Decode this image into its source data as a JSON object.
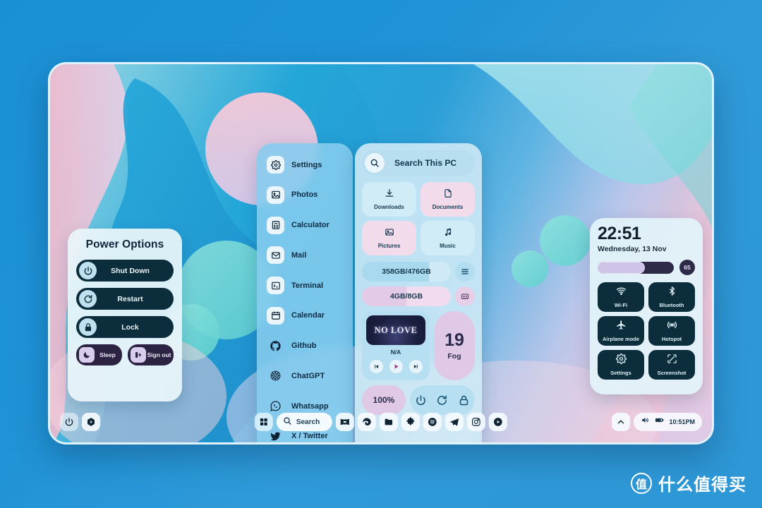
{
  "power_options": {
    "title": "Power Options",
    "buttons": [
      {
        "label": "Shut Down",
        "icon": "power-icon"
      },
      {
        "label": "Restart",
        "icon": "restart-icon"
      },
      {
        "label": "Lock",
        "icon": "lock-icon"
      }
    ],
    "small_buttons": [
      {
        "label": "Sleep",
        "icon": "moon-icon"
      },
      {
        "label": "Sign out",
        "icon": "signout-icon"
      }
    ],
    "colors": {
      "panel": "#e9f5fa",
      "button": "#0c2e3c",
      "small_button": "#2c2343"
    }
  },
  "app_list": {
    "items": [
      {
        "label": "Settings",
        "icon": "gear-icon"
      },
      {
        "label": "Photos",
        "icon": "image-icon"
      },
      {
        "label": "Calculator",
        "icon": "calculator-icon"
      },
      {
        "label": "Mail",
        "icon": "envelope-icon"
      },
      {
        "label": "Terminal",
        "icon": "terminal-icon"
      },
      {
        "label": "Calendar",
        "icon": "calendar-icon"
      },
      {
        "label": "Github",
        "icon": "github-icon"
      },
      {
        "label": "ChatGPT",
        "icon": "chatgpt-icon"
      },
      {
        "label": "Whatsapp",
        "icon": "whatsapp-icon"
      },
      {
        "label": "X / Twitter",
        "icon": "twitter-icon"
      }
    ]
  },
  "widgets": {
    "search": {
      "placeholder": "Search This PC",
      "icon": "search-icon"
    },
    "folders": [
      {
        "label": "Downloads",
        "icon": "download-icon",
        "tone": "blue"
      },
      {
        "label": "Documents",
        "icon": "document-icon",
        "tone": "pink"
      },
      {
        "label": "Pictures",
        "icon": "picture-icon",
        "tone": "pink"
      },
      {
        "label": "Music",
        "icon": "music-note-icon",
        "tone": "blue"
      }
    ],
    "storage": {
      "value": "358GB/476GB",
      "percent": 75,
      "icon": "drive-list-icon"
    },
    "ram": {
      "value": "4GB/8GB",
      "percent": 50,
      "icon": "memory-chip-icon"
    },
    "media": {
      "album": "NO LOVE",
      "track": "N/A",
      "prev": "prev-icon",
      "play": "play-icon",
      "next": "next-icon"
    },
    "weather": {
      "temp": "19",
      "condition": "Fog"
    },
    "battery": {
      "value": "100%"
    },
    "power_actions": [
      {
        "icon": "power-icon"
      },
      {
        "icon": "restart-icon"
      },
      {
        "icon": "lock-icon"
      }
    ]
  },
  "quick_settings": {
    "time": "22:51",
    "date": "Wednesday, 13 Nov",
    "brightness": {
      "value": "65",
      "percent": 62
    },
    "tiles": [
      {
        "label": "Wi-Fi",
        "icon": "wifi-icon"
      },
      {
        "label": "Bluetooth",
        "icon": "bluetooth-icon"
      },
      {
        "label": "Airplane mode",
        "icon": "airplane-icon"
      },
      {
        "label": "Hotspot",
        "icon": "hotspot-icon"
      },
      {
        "label": "Settings",
        "icon": "gear-icon"
      },
      {
        "label": "Screenshot",
        "icon": "screenshot-icon"
      }
    ]
  },
  "taskbar": {
    "left": [
      {
        "name": "power-icon"
      },
      {
        "name": "bolt-hexagon-icon"
      }
    ],
    "start": {
      "icon": "start-grid-icon"
    },
    "search": {
      "label": "Search",
      "icon": "search-icon"
    },
    "apps": [
      {
        "name": "widgets-icon"
      },
      {
        "name": "edge-icon"
      },
      {
        "name": "file-explorer-icon"
      },
      {
        "name": "puzzle-icon"
      },
      {
        "name": "spotify-icon"
      },
      {
        "name": "telegram-icon"
      },
      {
        "name": "instagram-icon"
      },
      {
        "name": "youtube-icon"
      }
    ],
    "tray": {
      "chevron": "chevron-up-icon",
      "volume": "speaker-icon",
      "battery": "battery-icon",
      "clock": "10:51PM"
    }
  },
  "watermark": {
    "logo": "值",
    "text": "什么值得买"
  }
}
